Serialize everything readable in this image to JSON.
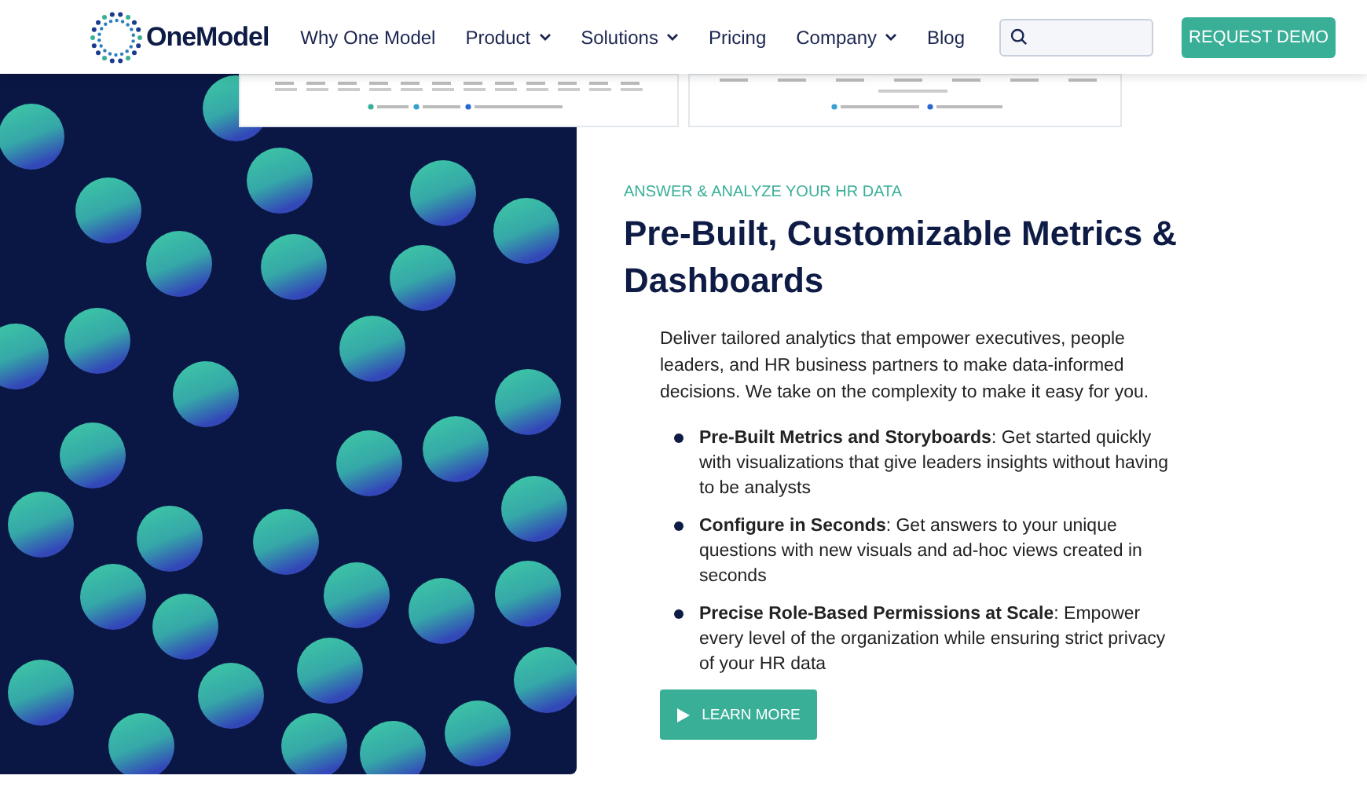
{
  "header": {
    "logo": "OneModel",
    "nav": [
      {
        "label": "Why One Model",
        "dropdown": false
      },
      {
        "label": "Product",
        "dropdown": true
      },
      {
        "label": "Solutions",
        "dropdown": true
      },
      {
        "label": "Pricing",
        "dropdown": false
      },
      {
        "label": "Company",
        "dropdown": true
      },
      {
        "label": "Blog",
        "dropdown": false
      }
    ],
    "cta": "REQUEST DEMO"
  },
  "hero": {
    "eyebrow": "ANSWER & ANALYZE YOUR HR DATA",
    "heading": "Pre-Built, Customizable Metrics & Dashboards",
    "intro": "Deliver tailored analytics that empower executives, people leaders, and HR business partners to make data-informed decisions. We take on the complexity to make it easy for you.",
    "bullets": [
      "**Pre-Built Metrics and Storyboards**: Get started quickly with visualizations that give leaders insights without having to be analysts",
      "**Configure in Seconds**: Get answers to your unique questions with new visuals and ad-hoc views created in seconds",
      "**Precise Role-Based Permissions at Scale**: Empower every level of the organization while ensuring strict privacy of your HR data"
    ],
    "button": "LEARN MORE"
  }
}
